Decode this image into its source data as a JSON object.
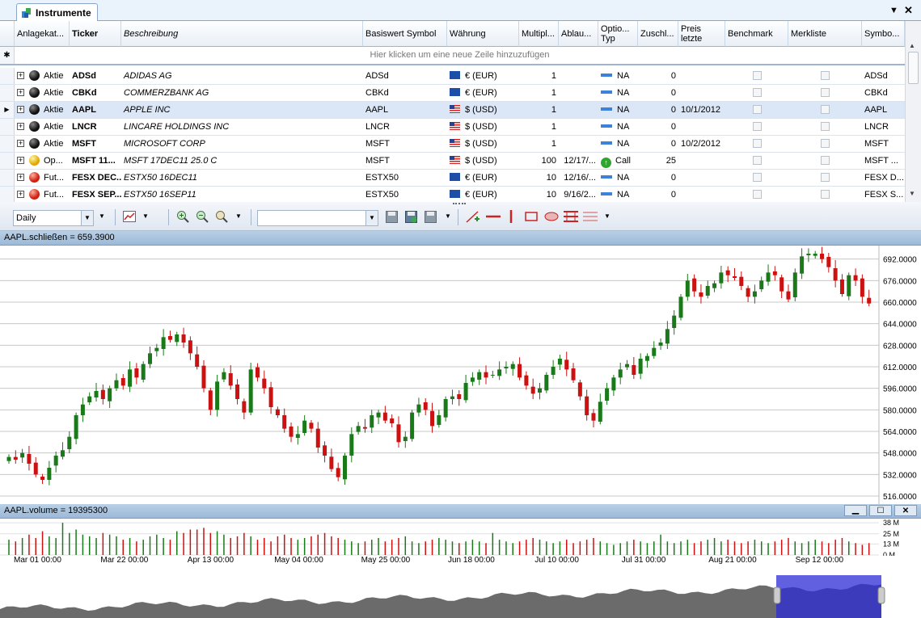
{
  "tab": {
    "title": "Instrumente"
  },
  "grid": {
    "columns": [
      "Anlagekat...",
      "Ticker",
      "Beschreibung",
      "Basiswert Symbol",
      "Währung",
      "Multipl...",
      "Ablau...",
      "Optio... Typ",
      "Zuschl...",
      "Preis letzte",
      "Benchmark",
      "Merkliste",
      "Symbo..."
    ],
    "new_row_text": "Hier klicken um eine neue Zeile hinzuzufügen",
    "rows": [
      {
        "cat": "Aktie",
        "ticker": "ADSd",
        "desc": "ADIDAS AG",
        "under": "ADSd",
        "cur": "€ (EUR)",
        "flag": "eu",
        "mult": "1",
        "exp": "",
        "opt": "NA",
        "zus": "0",
        "price": "",
        "sym": "ADSd",
        "ball": "black"
      },
      {
        "cat": "Aktie",
        "ticker": "CBKd",
        "desc": "COMMERZBANK AG",
        "under": "CBKd",
        "cur": "€ (EUR)",
        "flag": "eu",
        "mult": "1",
        "exp": "",
        "opt": "NA",
        "zus": "0",
        "price": "",
        "sym": "CBKd",
        "ball": "black"
      },
      {
        "cat": "Aktie",
        "ticker": "AAPL",
        "desc": "APPLE INC",
        "under": "AAPL",
        "cur": "$ (USD)",
        "flag": "us",
        "mult": "1",
        "exp": "",
        "opt": "NA",
        "zus": "0",
        "price": "10/1/2012",
        "sym": "AAPL",
        "ball": "black"
      },
      {
        "cat": "Aktie",
        "ticker": "LNCR",
        "desc": "LINCARE HOLDINGS INC",
        "under": "LNCR",
        "cur": "$ (USD)",
        "flag": "us",
        "mult": "1",
        "exp": "",
        "opt": "NA",
        "zus": "0",
        "price": "",
        "sym": "LNCR",
        "ball": "black"
      },
      {
        "cat": "Aktie",
        "ticker": "MSFT",
        "desc": "MICROSOFT CORP",
        "under": "MSFT",
        "cur": "$ (USD)",
        "flag": "us",
        "mult": "1",
        "exp": "",
        "opt": "NA",
        "zus": "0",
        "price": "10/2/2012",
        "sym": "MSFT",
        "ball": "black"
      },
      {
        "cat": "Op...",
        "ticker": "MSFT 11...",
        "desc": "MSFT 17DEC11 25.0 C",
        "under": "MSFT",
        "cur": "$ (USD)",
        "flag": "us",
        "mult": "100",
        "exp": "12/17/...",
        "opt": "Call",
        "zus": "25",
        "price": "",
        "sym": "MSFT ...",
        "ball": "yellow"
      },
      {
        "cat": "Fut...",
        "ticker": "FESX DEC...",
        "desc": "ESTX50 16DEC11",
        "under": "ESTX50",
        "cur": "€ (EUR)",
        "flag": "eu",
        "mult": "10",
        "exp": "12/16/...",
        "opt": "NA",
        "zus": "0",
        "price": "",
        "sym": "FESX D...",
        "ball": "red"
      },
      {
        "cat": "Fut...",
        "ticker": "FESX SEP...",
        "desc": "ESTX50 16SEP11",
        "under": "ESTX50",
        "cur": "€ (EUR)",
        "flag": "eu",
        "mult": "10",
        "exp": "9/16/2...",
        "opt": "NA",
        "zus": "0",
        "price": "",
        "sym": "FESX S...",
        "ball": "red"
      }
    ]
  },
  "toolbar": {
    "period": "Daily",
    "template": ""
  },
  "price_panel": {
    "title": "AAPL.schließen = 659.3900"
  },
  "volume_panel": {
    "title": "AAPL.volume = 19395300",
    "ticks": [
      "38 M",
      "25 M",
      "13 M",
      "0 M"
    ]
  },
  "x_labels": [
    "Mar 01 00:00",
    "Mar 22 00:00",
    "Apr 13 00:00",
    "May 04 00:00",
    "May 25 00:00",
    "Jun 18 00:00",
    "Jul 10 00:00",
    "Jul 31 00:00",
    "Aug 21 00:00",
    "Sep 12 00:00"
  ],
  "chart_data": {
    "type": "candlestick",
    "title": "AAPL.schließen = 659.3900",
    "y_ticks": [
      692,
      676,
      660,
      644,
      628,
      612,
      596,
      580,
      564,
      548,
      532,
      516
    ],
    "ylim": [
      510,
      702
    ],
    "closes": [
      545,
      543,
      548,
      540,
      532,
      528,
      537,
      546,
      550,
      560,
      576,
      584,
      590,
      594,
      588,
      596,
      602,
      598,
      610,
      604,
      614,
      622,
      626,
      634,
      632,
      636,
      630,
      622,
      612,
      596,
      580,
      601,
      608,
      598,
      588,
      578,
      610,
      604,
      596,
      582,
      576,
      566,
      560,
      562,
      572,
      566,
      552,
      546,
      536,
      530,
      546,
      562,
      568,
      566,
      576,
      578,
      572,
      570,
      556,
      560,
      578,
      584,
      580,
      568,
      576,
      588,
      590,
      588,
      600,
      604,
      608,
      604,
      606,
      610,
      612,
      614,
      604,
      598,
      592,
      596,
      606,
      612,
      618,
      610,
      602,
      590,
      576,
      572,
      586,
      596,
      604,
      610,
      614,
      606,
      618,
      620,
      626,
      630,
      640,
      650,
      664,
      676,
      668,
      664,
      672,
      674,
      682,
      680,
      678,
      672,
      664,
      668,
      676,
      682,
      680,
      668,
      662,
      682,
      694,
      696,
      696,
      692,
      686,
      676,
      666,
      680,
      676,
      664,
      659
    ],
    "volumes": [
      18,
      16,
      20,
      24,
      20,
      28,
      22,
      20,
      38,
      26,
      30,
      24,
      22,
      20,
      26,
      24,
      22,
      18,
      20,
      16,
      18,
      22,
      24,
      20,
      18,
      28,
      26,
      30,
      30,
      32,
      26,
      28,
      24,
      20,
      22,
      26,
      22,
      18,
      20,
      16,
      22,
      24,
      20,
      18,
      20,
      22,
      24,
      26,
      22,
      20,
      18,
      16,
      14,
      16,
      18,
      20,
      16,
      18,
      20,
      22,
      16,
      14,
      16,
      18,
      20,
      18,
      16,
      14,
      16,
      18,
      16,
      14,
      26,
      18,
      16,
      14,
      16,
      18,
      20,
      18,
      16,
      14,
      16,
      18,
      14,
      16,
      18,
      20,
      16,
      14,
      12,
      14,
      16,
      18,
      16,
      14,
      16,
      24,
      16,
      14,
      16,
      18,
      14,
      16,
      18,
      20,
      16,
      18,
      16,
      14,
      16,
      18,
      16,
      14,
      16,
      18,
      20,
      16,
      14,
      16,
      18,
      16,
      14,
      18,
      20,
      16,
      14,
      12,
      14
    ]
  }
}
